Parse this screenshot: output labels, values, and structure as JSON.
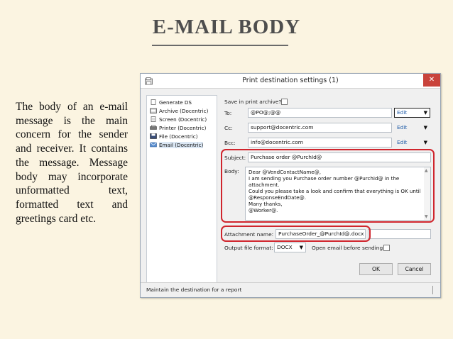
{
  "slide": {
    "title": "E-MAIL BODY",
    "body": "The body of an e-mail message is the main concern for the sender and receiver. It contains the message. Message body may incorporate unformatted text, formatted text and greetings card etc."
  },
  "dialog": {
    "title": "Print destination settings (1)",
    "close_label": "✕",
    "tree": [
      {
        "label": "Generate DS",
        "icon": "doc-icon"
      },
      {
        "label": "Archive (Docentric)",
        "icon": "archive-icon"
      },
      {
        "label": "Screen (Docentric)",
        "icon": "screen-icon"
      },
      {
        "label": "Printer (Docentric)",
        "icon": "printer-icon"
      },
      {
        "label": "File (Docentric)",
        "icon": "file-icon"
      },
      {
        "label": "Email (Docentric)",
        "icon": "email-icon"
      }
    ],
    "archive_label": "Save in print archive?",
    "to_label": "To:",
    "to_value": "@PO@;@@",
    "to_edit": "Edit",
    "cc_label": "Cc:",
    "cc_value": "support@docentric.com",
    "cc_edit": "Edit",
    "bcc_label": "Bcc:",
    "bcc_value": "info@docentric.com",
    "bcc_edit": "Edit",
    "subject_label": "Subject:",
    "subject_value": "Purchase order @PurchId@",
    "body_label": "Body:",
    "body_lines": [
      "Dear @VendContactName@,",
      "I am sending you Purchase order number @PurchId@ in the",
      "attachment.",
      "Could you please take a look and confirm that everything is OK until",
      "@ResponseEndDate@.",
      "Many thanks,",
      "@Worker@."
    ],
    "attachment_label": "Attachment name:",
    "attachment_value": "PurchaseOrder_@PurchId@.docx",
    "output_label": "Output file format:",
    "output_value": "DOCX",
    "open_email_label": "Open email before sending:",
    "ok_label": "OK",
    "cancel_label": "Cancel",
    "status_text": "Maintain the destination for a report"
  },
  "colors": {
    "slide_background": "#fbf4e1",
    "highlight": "#d0252d",
    "link_blue": "#1f5ca8"
  }
}
